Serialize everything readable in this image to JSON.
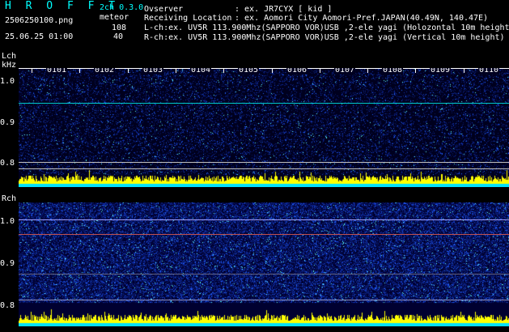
{
  "header": {
    "app_title": "H R O F F T",
    "channel_mode": "2ch 0.3.0",
    "filename": "2506250100.png",
    "meteor_label": "meteor",
    "meteor_l_count": "108",
    "meteor_r_count": "40",
    "datetime": "25.06.25 01:00",
    "observer_label": "Ovserver",
    "observer_value": ": ex. JR7CYX [ kid ]",
    "location_label": "Receiving Location",
    "location_value": ": ex. Aomori City Aomori-Pref.JAPAN(40.49N, 140.47E)",
    "lch_info": "L-ch:ex. UV5R 113.900Mhz(SAPPORO VOR)USB ,2-ele yagi (Holozontal 10m height)",
    "rch_info": "R-ch:ex. UV5R 113.900Mhz(SAPPORO VOR)USB ,2-ele yagi (Vertical 10m height)"
  },
  "lch": {
    "label": "Lch",
    "unit": "kHz",
    "yticks": [
      "1.0",
      "0.9",
      "0.8"
    ]
  },
  "rch": {
    "label": "Rch",
    "yticks": [
      "1.0",
      "0.9",
      "0.8"
    ]
  },
  "time_labels": [
    "0101",
    "0102",
    "0103",
    "0104",
    "0105",
    "0106",
    "0107",
    "0108",
    "0109",
    "0110"
  ],
  "colors": {
    "accent_cyan": "#00ffff",
    "meteor_yellow": "#ffff00",
    "background": "#000000",
    "noise_blue": "#0000ff"
  }
}
